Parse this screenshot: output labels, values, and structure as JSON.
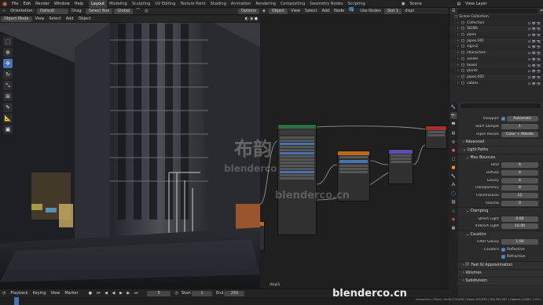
{
  "menubar": {
    "menus": [
      "File",
      "Edit",
      "Render",
      "Window",
      "Help"
    ],
    "workspaces": [
      "Layout",
      "Modeling",
      "Sculpting",
      "UV Editing",
      "Texture Paint",
      "Shading",
      "Animation",
      "Rendering",
      "Compositing",
      "Geometry Nodes",
      "Scripting"
    ],
    "active_workspace": "Layout",
    "scene_label": "Scene",
    "view_layer_label": "View Layer"
  },
  "tool_header": {
    "orientation_label": "Orientation:",
    "orientation_value": "Default",
    "drag_label": "Drag:",
    "drag_value": "Select Box",
    "transform_value": "Global",
    "options_label": "Options"
  },
  "viewport_header": {
    "mode": "Object Mode",
    "menus": [
      "View",
      "Select",
      "Add",
      "Object"
    ]
  },
  "node_header": {
    "object_mode": "Object",
    "menus": [
      "View",
      "Select",
      "Add",
      "Node"
    ],
    "use_nodes_label": "Use Nodes",
    "slot": "Slot 1",
    "material": "displ"
  },
  "node_editor": {
    "material_label": "displ1"
  },
  "outliner": {
    "root": "Scene Collection",
    "items": [
      "Collection",
      "SIGNS",
      "pipes",
      "pipes.001",
      "signs2",
      "characters",
      "assets",
      "boxes",
      "plants",
      "pipes.002",
      "cables"
    ]
  },
  "properties": {
    "viewport_label": "Viewport",
    "viewport_value": "Automatic",
    "start_sample_label": "Start Sample",
    "start_sample_value": "1",
    "input_passes_label": "Input Passes",
    "input_passes_value": "Color + Albedo",
    "sections": {
      "advanced": "Advanced",
      "light_paths": "Light Paths",
      "max_bounces": "Max Bounces",
      "clamping": "Clamping",
      "caustics": "Caustics",
      "fast_gi": "Fast GI Approximation",
      "volumes": "Volumes",
      "subdivision": "Subdivision"
    },
    "bounces": [
      {
        "label": "Total",
        "value": "6"
      },
      {
        "label": "Diffuse",
        "value": "4"
      },
      {
        "label": "Glossy",
        "value": "4"
      },
      {
        "label": "Transparency",
        "value": "8"
      },
      {
        "label": "Transmission",
        "value": "12"
      },
      {
        "label": "Volume",
        "value": "0"
      }
    ],
    "clamping": [
      {
        "label": "Direct Light",
        "value": "0.00"
      },
      {
        "label": "Indirect Light",
        "value": "10.00"
      }
    ],
    "filter_glossy_label": "Filter Glossy",
    "filter_glossy_value": "1.00",
    "caustics_label": "Caustics",
    "reflective_label": "Reflective",
    "refractive_label": "Refractive"
  },
  "timeline": {
    "menus": [
      "Playback",
      "Keying",
      "View",
      "Marker"
    ],
    "current_frame": "5",
    "start_label": "Start",
    "start_value": "1",
    "end_label": "End",
    "end_value": "250"
  },
  "status_bar": "characters | Plane | Verts:175,820 | Faces:190,995 | Tris:302,967 | Objects:1/189 | 2.93.1",
  "watermark": {
    "logo_text": "布韵",
    "brand_text": "blenderco",
    "domain_text": "blenderco.cn"
  },
  "colors": {
    "accent": "#4772b3",
    "node_green": "#2c6b45",
    "node_orange": "#b86b1e",
    "node_purple": "#5b4ea8",
    "node_red": "#a33030",
    "node_link": "#a0a0a0"
  }
}
